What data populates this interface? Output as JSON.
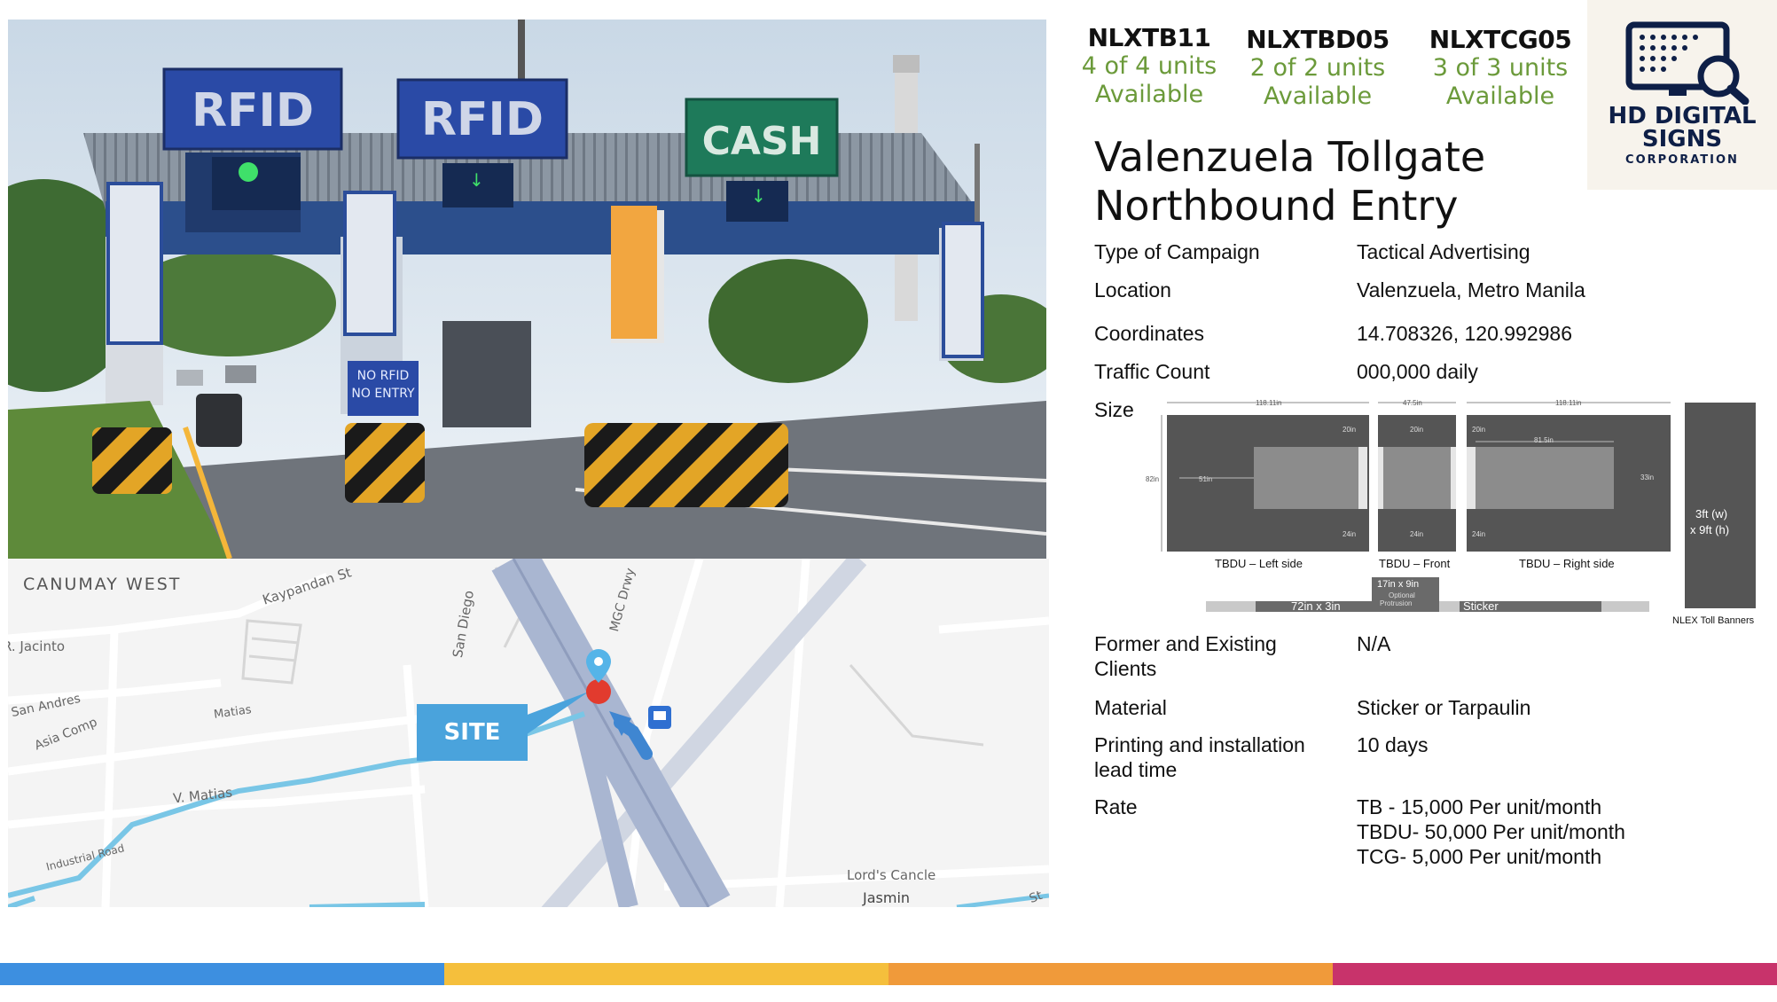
{
  "photo": {
    "signs": [
      "RFID",
      "RFID",
      "CASH"
    ],
    "no_entry_sign": [
      "NO RFID",
      "NO ENTRY"
    ]
  },
  "map": {
    "labels": {
      "canumay": "CANUMAY WEST",
      "kaypandan": "Kaypandan St",
      "jacinto": "R. Jacinto",
      "san_andres": "San Andres",
      "asia_comp": "Asia Comp",
      "matias": "Matias",
      "v_matias": "V. Matias",
      "industrial": "Industrial Road",
      "san_diego": "San Diego",
      "mgc": "MGC Drwy",
      "lords": "Lord's Cancle",
      "jasmin": "Jasmin",
      "st": "St"
    },
    "site_label": "SITE",
    "road_color": "#a9b6d1",
    "water_color": "#79c6e6"
  },
  "units": [
    {
      "code": "NLXTB11",
      "count": "4 of 4 units",
      "status": "Available"
    },
    {
      "code": "NLXTBD05",
      "count": "2 of 2 units",
      "status": "Available"
    },
    {
      "code": "NLXTCG05",
      "count": "3 of 3 units",
      "status": "Available"
    }
  ],
  "logo": {
    "line1": "HD DIGITAL",
    "line2": "SIGNS",
    "line3": "CORPORATION"
  },
  "title": {
    "line1": "Valenzuela Tollgate",
    "line2": "Northbound Entry"
  },
  "specs": {
    "campaign_label": "Type of Campaign",
    "campaign_value": "Tactical Advertising",
    "location_label": "Location",
    "location_value": "Valenzuela, Metro Manila",
    "coords_label": "Coordinates",
    "coords_value": "14.708326, 120.992986",
    "traffic_label": "Traffic Count",
    "traffic_value": "000,000 daily",
    "size_label": "Size",
    "clients_label_1": "Former and Existing",
    "clients_label_2": "Clients",
    "clients_value": "N/A",
    "material_label": "Material",
    "material_value": "Sticker or Tarpaulin",
    "lead_label_1": "Printing and installation",
    "lead_label_2": "lead time",
    "lead_value": "10 days",
    "rate_label": "Rate",
    "rate_1": "TB - 15,000 Per unit/month",
    "rate_2": "TBDU- 50,000 Per unit/month",
    "rate_3": "TCG- 5,000 Per unit/month"
  },
  "size_diagram": {
    "left_caption": "TBDU – Left side",
    "front_caption": "TBDU – Front",
    "right_caption": "TBDU – Right side",
    "banner_caption": "NLEX Toll Banners",
    "banner_size_1": "3ft (w)",
    "banner_size_2": "x 9ft (h)",
    "sticker_1": "72in x 3in",
    "sticker_2": "Sticker",
    "protrusion_1": "17in x 9in",
    "protrusion_2": "Optional",
    "protrusion_3": "Protrusion",
    "dims": {
      "left_width": "118.11in",
      "front_width": "47.5in",
      "right_width": "118.11in",
      "left_height": "82in",
      "left_inner": "51in",
      "right_inner": "81.5in",
      "right_side": "33in",
      "top_20": "20in",
      "bottom_24": "24in"
    }
  },
  "footer_colors": [
    "#3d8fe0",
    "#f5bf3c",
    "#f09a3a",
    "#c8336b"
  ]
}
